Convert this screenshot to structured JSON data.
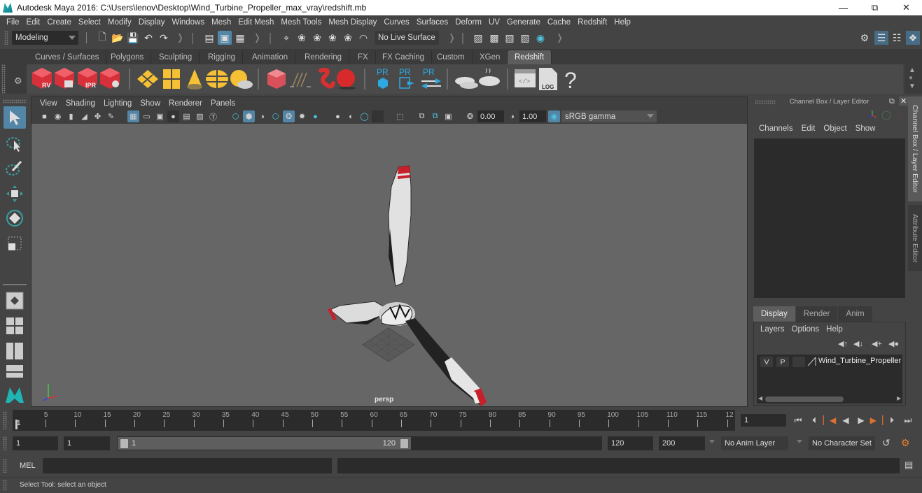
{
  "window": {
    "title": "Autodesk Maya 2016: C:\\Users\\lenov\\Desktop\\Wind_Turbine_Propeller_max_vray\\redshift.mb",
    "minimize_icon": "minimize-icon",
    "maximize_icon": "restore-icon",
    "close_icon": "close-icon"
  },
  "menubar": [
    "File",
    "Edit",
    "Create",
    "Select",
    "Modify",
    "Display",
    "Windows",
    "Mesh",
    "Edit Mesh",
    "Mesh Tools",
    "Mesh Display",
    "Curves",
    "Surfaces",
    "Deform",
    "UV",
    "Generate",
    "Cache",
    "Redshift",
    "Help"
  ],
  "statusline": {
    "menuset": "Modeling",
    "live_surface": "No Live Surface"
  },
  "shelf": {
    "tabs": [
      "Curves / Surfaces",
      "Polygons",
      "Sculpting",
      "Rigging",
      "Animation",
      "Rendering",
      "FX",
      "FX Caching",
      "Custom",
      "XGen",
      "Redshift"
    ],
    "active_tab": "Redshift",
    "buttons": [
      {
        "icon": "redshift-render-view-icon",
        "badge": "RV"
      },
      {
        "icon": "redshift-batch-render-icon",
        "badge": ""
      },
      {
        "icon": "redshift-ipr-icon",
        "badge": "IPR"
      },
      {
        "icon": "redshift-render-settings-icon",
        "badge": ""
      },
      {
        "icon": "area-light-icon"
      },
      {
        "icon": "portal-light-icon"
      },
      {
        "icon": "spot-light-icon"
      },
      {
        "icon": "dome-light-icon"
      },
      {
        "icon": "sun-sky-icon"
      },
      {
        "icon": "volume-icon"
      },
      {
        "icon": "hair-icon"
      },
      {
        "icon": "sprite-icon"
      },
      {
        "icon": "material-ball-icon"
      },
      {
        "icon": "proxy-icon",
        "badge": "PR"
      },
      {
        "icon": "proxy-export-icon",
        "badge": "PR"
      },
      {
        "icon": "proxy-convert-icon",
        "badge": "PR"
      },
      {
        "icon": "bake-icon"
      },
      {
        "icon": "bake-set-icon"
      },
      {
        "icon": "script-icon"
      },
      {
        "icon": "log-icon",
        "badge": "LOG"
      },
      {
        "icon": "help-icon",
        "badge": "?"
      }
    ]
  },
  "viewport": {
    "menus": [
      "View",
      "Shading",
      "Lighting",
      "Show",
      "Renderer",
      "Panels"
    ],
    "exposure": "0.00",
    "gamma": "1.00",
    "color_space": "sRGB gamma",
    "camera": "persp"
  },
  "channel_box": {
    "title": "Channel Box / Layer Editor",
    "menus": [
      "Channels",
      "Edit",
      "Object",
      "Show"
    ],
    "layer_tabs": [
      "Display",
      "Render",
      "Anim"
    ],
    "active_layer_tab": "Display",
    "layer_menus": [
      "Layers",
      "Options",
      "Help"
    ],
    "layers": [
      {
        "visible": "V",
        "playback": "P",
        "name": "Wind_Turbine_Propeller"
      }
    ]
  },
  "side_tabs": [
    "Channel Box / Layer Editor",
    "Attribute Editor"
  ],
  "timeline": {
    "ticks": [
      "5",
      "10",
      "15",
      "20",
      "25",
      "30",
      "35",
      "40",
      "45",
      "50",
      "55",
      "60",
      "65",
      "70",
      "75",
      "80",
      "85",
      "90",
      "95",
      "100",
      "105",
      "110",
      "115",
      "12"
    ],
    "start_label": "1",
    "current_frame": "1"
  },
  "range": {
    "start": "1",
    "playback_start": "1",
    "slider_start": "1",
    "slider_end": "120",
    "playback_end": "120",
    "end": "200",
    "anim_layer": "No Anim Layer",
    "character_set": "No Character Set"
  },
  "command": {
    "lang": "MEL",
    "input": "",
    "result": ""
  },
  "help_line": "Select Tool: select an object"
}
